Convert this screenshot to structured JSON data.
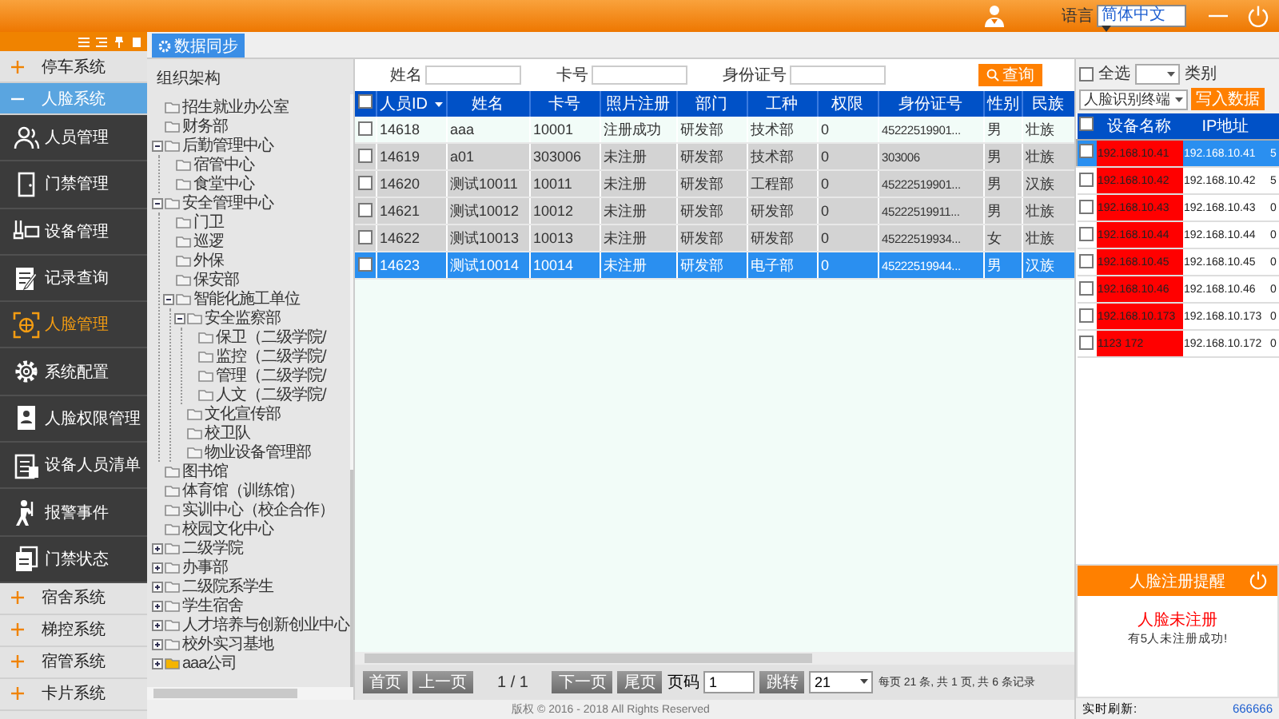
{
  "header": {
    "language_label": "语言",
    "language": "简体中文"
  },
  "sidebar": {
    "groups": [
      {
        "label": "停车系统",
        "expanded": false,
        "selected": false
      },
      {
        "label": "人脸系统",
        "expanded": true,
        "selected": true,
        "children": [
          {
            "label": "人员管理",
            "selected": false
          },
          {
            "label": "门禁管理",
            "selected": false
          },
          {
            "label": "设备管理",
            "selected": false
          },
          {
            "label": "记录查询",
            "selected": false
          },
          {
            "label": "人脸管理",
            "selected": true
          },
          {
            "label": "系统配置",
            "selected": false
          },
          {
            "label": "人脸权限管理",
            "selected": false
          },
          {
            "label": "设备人员清单",
            "selected": false
          },
          {
            "label": "报警事件",
            "selected": false
          },
          {
            "label": "门禁状态",
            "selected": false
          }
        ]
      },
      {
        "label": "宿舍系统",
        "expanded": false,
        "selected": false
      },
      {
        "label": "梯控系统",
        "expanded": false,
        "selected": false
      },
      {
        "label": "宿管系统",
        "expanded": false,
        "selected": false
      },
      {
        "label": "卡片系统",
        "expanded": false,
        "selected": false
      }
    ]
  },
  "tabs": [
    {
      "label": "数据同步",
      "selected": true
    }
  ],
  "tree": {
    "title": "组织架构",
    "items": [
      {
        "label": "招生就业办公室"
      },
      {
        "label": "财务部"
      },
      {
        "label": "后勤管理中心",
        "expanded": true,
        "children": [
          {
            "label": "宿管中心"
          },
          {
            "label": "食堂中心"
          }
        ]
      },
      {
        "label": "安全管理中心",
        "expanded": true,
        "children": [
          {
            "label": "门卫"
          },
          {
            "label": "巡逻"
          },
          {
            "label": "外保"
          },
          {
            "label": "保安部"
          },
          {
            "label": "智能化施工单位",
            "expanded": true,
            "children": [
              {
                "label": "安全监察部",
                "expanded": true,
                "children": [
                  {
                    "label": "保卫（二级学院/"
                  },
                  {
                    "label": "监控（二级学院/"
                  },
                  {
                    "label": "管理（二级学院/"
                  },
                  {
                    "label": "人文（二级学院/"
                  }
                ]
              },
              {
                "label": "文化宣传部"
              },
              {
                "label": "校卫队"
              },
              {
                "label": "物业设备管理部"
              }
            ]
          }
        ]
      },
      {
        "label": "图书馆"
      },
      {
        "label": "体育馆（训练馆）"
      },
      {
        "label": "实训中心（校企合作）"
      },
      {
        "label": "校园文化中心"
      },
      {
        "label": "二级学院",
        "expanded": false
      },
      {
        "label": "办事部",
        "expanded": false
      },
      {
        "label": "二级院系学生",
        "expanded": false
      },
      {
        "label": "学生宿舍",
        "expanded": false
      },
      {
        "label": "人才培养与创新创业中心",
        "expanded": false
      },
      {
        "label": "校外实习基地",
        "expanded": false
      },
      {
        "label": "aaa公司",
        "expanded": false
      }
    ]
  },
  "filters": {
    "fields": [
      {
        "label": "姓名"
      },
      {
        "label": "卡号"
      },
      {
        "label": "身份证号"
      }
    ],
    "button": "查询"
  },
  "table": {
    "all_checked": false,
    "columns": [
      "人员ID",
      "姓名",
      "卡号",
      "照片注册",
      "部门",
      "工种",
      "权限",
      "身份证号",
      "性别",
      "民族"
    ],
    "rows": [
      {
        "checked": false,
        "selected": false,
        "cells": [
          "14618",
          "aaa",
          "10001",
          "注册成功",
          "研发部",
          "技术部",
          "0",
          "45222519901...",
          "男",
          "壮族"
        ]
      },
      {
        "checked": false,
        "selected": false,
        "cells": [
          "14619",
          "a01",
          "303006",
          "未注册",
          "研发部",
          "技术部",
          "0",
          "303006",
          "男",
          "壮族"
        ]
      },
      {
        "checked": false,
        "selected": false,
        "cells": [
          "14620",
          "测试10011",
          "10011",
          "未注册",
          "研发部",
          "工程部",
          "0",
          "45222519901...",
          "男",
          "汉族"
        ]
      },
      {
        "checked": false,
        "selected": false,
        "cells": [
          "14621",
          "测试10012",
          "10012",
          "未注册",
          "研发部",
          "研发部",
          "0",
          "45222519911...",
          "男",
          "壮族"
        ]
      },
      {
        "checked": false,
        "selected": false,
        "cells": [
          "14622",
          "测试10013",
          "10013",
          "未注册",
          "研发部",
          "研发部",
          "0",
          "45222519934...",
          "女",
          "壮族"
        ]
      },
      {
        "checked": false,
        "selected": true,
        "cells": [
          "14623",
          "测试10014",
          "10014",
          "未注册",
          "研发部",
          "电子部",
          "0",
          "45222519944...",
          "男",
          "汉族"
        ]
      }
    ]
  },
  "pager": {
    "first": "首页",
    "prev": "上一页",
    "page": "1 / 1",
    "next": "下一页",
    "last": "尾页",
    "goto_label": "页码",
    "goto_value": "1",
    "jump": "跳转",
    "page_size": "21",
    "summary": "每页 21 条, 共 1 页, 共 6 条记录"
  },
  "footer": "版权 © 2016 - 2018 All Rights Reserved",
  "devices": {
    "all_checked": false,
    "select_all": "全选",
    "select_all_checked": false,
    "category_label": "类别",
    "category": "人脸识别终端",
    "write_button": "写入数据",
    "columns": [
      "设备名称",
      "IP地址"
    ],
    "rows": [
      {
        "name": "192.168.10.41",
        "ip": "192.168.10.41",
        "column_3": "5",
        "checked": false,
        "selected": true,
        "offline": true
      },
      {
        "name": "192.168.10.42",
        "ip": "192.168.10.42",
        "column_3": "5",
        "checked": false,
        "selected": false,
        "offline": true
      },
      {
        "name": "192.168.10.43",
        "ip": "192.168.10.43",
        "column_3": "0",
        "checked": false,
        "selected": false,
        "offline": true
      },
      {
        "name": "192.168.10.44",
        "ip": "192.168.10.44",
        "column_3": "0",
        "checked": false,
        "selected": false,
        "offline": true
      },
      {
        "name": "192.168.10.45",
        "ip": "192.168.10.45",
        "column_3": "0",
        "checked": false,
        "selected": false,
        "offline": true
      },
      {
        "name": "192.168.10.46",
        "ip": "192.168.10.46",
        "column_3": "0",
        "checked": false,
        "selected": false,
        "offline": true
      },
      {
        "name": "192.168.10.173",
        "ip": "192.168.10.173",
        "column_3": "0",
        "checked": false,
        "selected": false,
        "offline": true
      },
      {
        "name": "1123 172",
        "ip": "192.168.10.172",
        "column_3": "0",
        "checked": false,
        "selected": false,
        "offline": true
      }
    ]
  },
  "notice": {
    "title": "人脸注册提醒",
    "headline": "人脸未注册",
    "message": "有5人未注册成功!"
  },
  "status": {
    "label": "实时刷新:",
    "value": "666666"
  }
}
